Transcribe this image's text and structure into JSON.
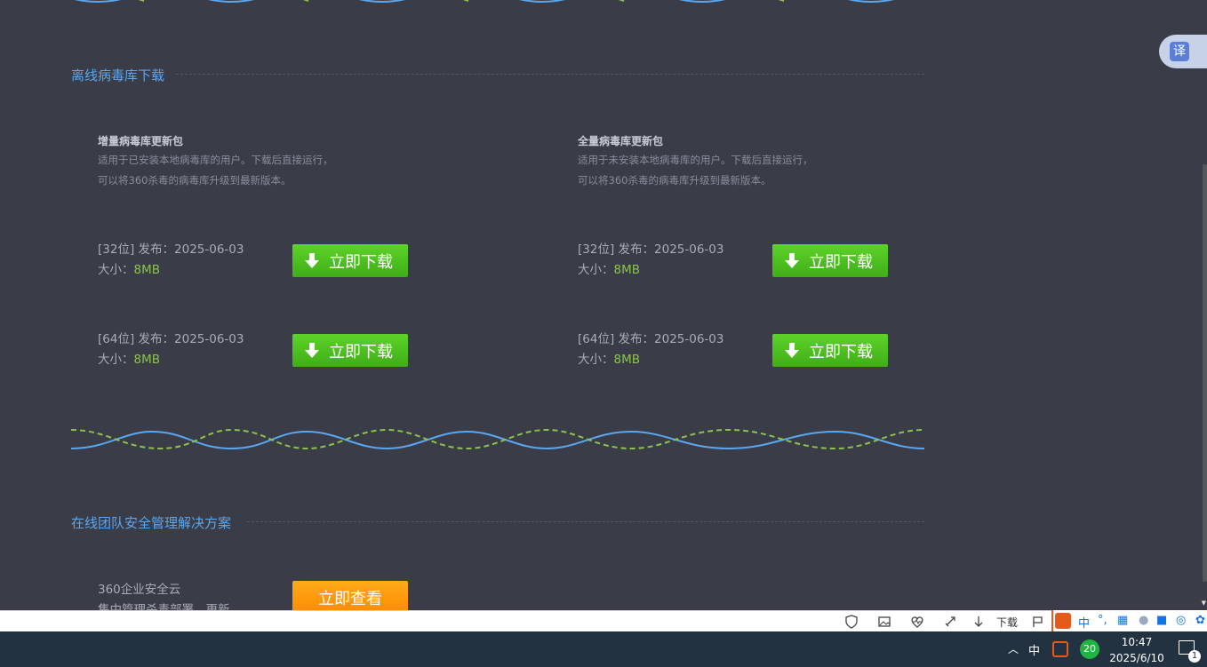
{
  "sections": {
    "offline": {
      "title": "离线病毒库下载"
    },
    "enterprise": {
      "title": "在线团队安全管理解决方案"
    }
  },
  "packages": [
    {
      "title": "增量病毒库更新包",
      "desc1": "适用于已安装本地病毒库的用户。下载后直接运行，",
      "desc2": "可以将360杀毒的病毒库升级到最新版本。",
      "versions": [
        {
          "bits": "[32位]",
          "release_label": "发布：",
          "date": "2025-06-03",
          "size_label": "大小：",
          "size": "8MB",
          "button": "立即下载"
        },
        {
          "bits": "[64位]",
          "release_label": "发布：",
          "date": "2025-06-03",
          "size_label": "大小：",
          "size": "8MB",
          "button": "立即下载"
        }
      ]
    },
    {
      "title": "全量病毒库更新包",
      "desc1": "适用于未安装本地病毒库的用户。下载后直接运行，",
      "desc2": "可以将360杀毒的病毒库升级到最新版本。",
      "versions": [
        {
          "bits": "[32位]",
          "release_label": "发布：",
          "date": "2025-06-03",
          "size_label": "大小：",
          "size": "8MB",
          "button": "立即下载"
        },
        {
          "bits": "[64位]",
          "release_label": "发布：",
          "date": "2025-06-03",
          "size_label": "大小：",
          "size": "8MB",
          "button": "立即下载"
        }
      ]
    }
  ],
  "enterprise": {
    "name": "360企业安全云",
    "desc": "集中管理杀毒部署，更新",
    "button": "立即查看"
  },
  "translate": {
    "label": "译"
  },
  "browser_bar": {
    "download_label": "下载"
  },
  "ime": {
    "lang": "中"
  },
  "taskbar": {
    "lang": "中",
    "badge": "20",
    "time": "10:47",
    "date": "2025/6/10",
    "notifications": "1"
  },
  "colors": {
    "accent_blue": "#5aa7f0",
    "download_green": "#4cc21f",
    "view_orange": "#ff9500",
    "background": "#3a3c48"
  }
}
